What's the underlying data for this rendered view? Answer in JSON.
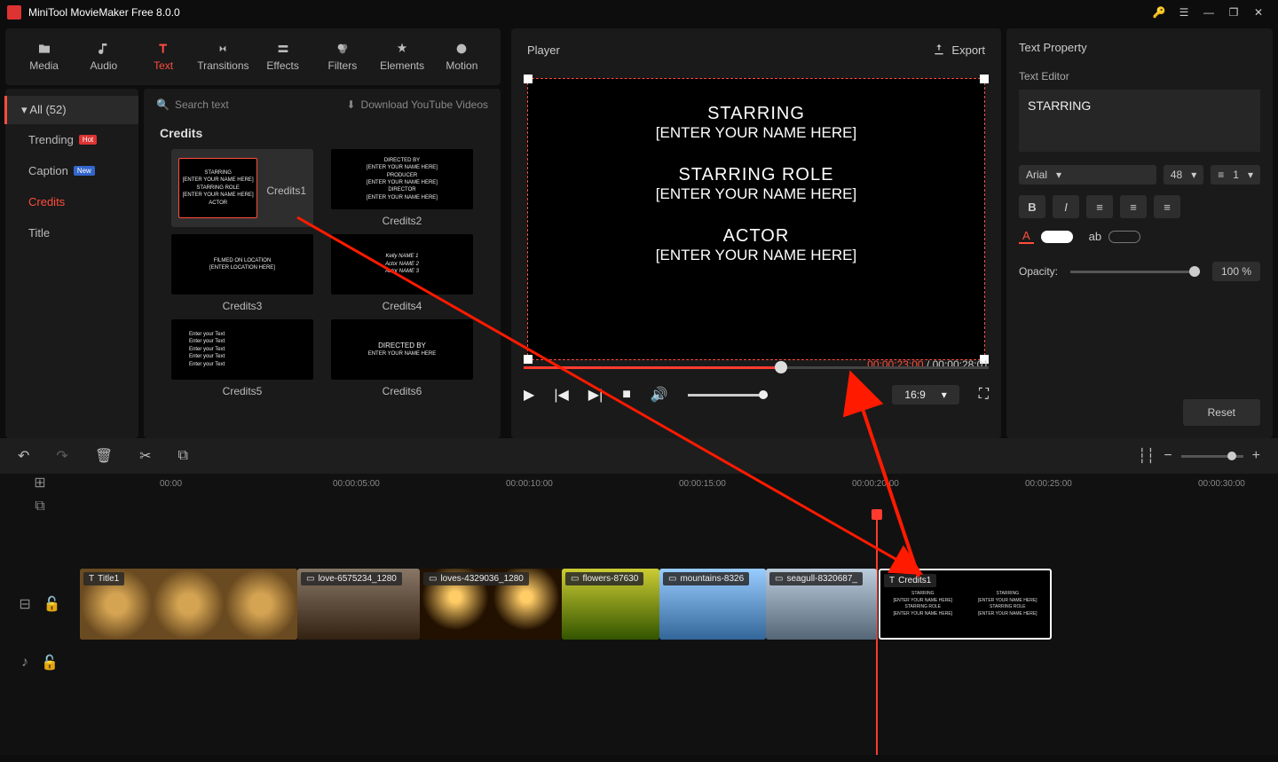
{
  "app": {
    "title": "MiniTool MovieMaker Free 8.0.0"
  },
  "tabs": [
    {
      "label": "Media"
    },
    {
      "label": "Audio"
    },
    {
      "label": "Text"
    },
    {
      "label": "Transitions"
    },
    {
      "label": "Effects"
    },
    {
      "label": "Filters"
    },
    {
      "label": "Elements"
    },
    {
      "label": "Motion"
    }
  ],
  "categories": {
    "all": "All (52)",
    "items": [
      {
        "label": "Trending",
        "badge": "Hot"
      },
      {
        "label": "Caption",
        "badge": "New"
      },
      {
        "label": "Credits",
        "active": true
      },
      {
        "label": "Title"
      }
    ]
  },
  "search": {
    "placeholder": "Search text",
    "download": "Download YouTube Videos"
  },
  "heading": "Credits",
  "thumbs": [
    "Credits1",
    "Credits2",
    "Credits3",
    "Credits4",
    "Credits5",
    "Credits6"
  ],
  "thumb_lines": {
    "c1": [
      "STARRING",
      "[ENTER YOUR NAME HERE]",
      "STARRING ROLE",
      "[ENTER YOUR NAME HERE]",
      "ACTOR"
    ],
    "c2": [
      "DIRECTED BY",
      "[ENTER YOUR NAME HERE]",
      "PRODUCER",
      "[ENTER YOUR NAME HERE]",
      "DIRECTOR",
      "[ENTER YOUR NAME HERE]"
    ],
    "c3": [
      "FILMED ON LOCATION",
      "[ENTER LOCATION HERE]"
    ],
    "c4": [
      "Kelly NAME 1",
      "Actor NAME 2",
      "Actor NAME 3"
    ],
    "c5": [
      "Enter your Text",
      "Enter your Text",
      "Enter your Text",
      "Enter your Text",
      "Enter your Text"
    ],
    "c6": [
      "DIRECTED BY",
      "ENTER YOUR NAME HERE"
    ]
  },
  "player": {
    "title": "Player",
    "export": "Export",
    "lines": {
      "l1": "STARRING",
      "l2": "[ENTER YOUR NAME HERE]",
      "l3": "STARRING ROLE",
      "l4": "[ENTER YOUR NAME HERE]",
      "l5": "ACTOR",
      "l6": "[ENTER YOUR NAME HERE]"
    },
    "time_current": "00:00:23:00",
    "time_sep": " / ",
    "time_total": "00:00:28:01",
    "aspect": "16:9"
  },
  "props": {
    "title": "Text Property",
    "editor": "Text Editor",
    "text": "STARRING",
    "font": "Arial",
    "size": "48",
    "spacing": "1",
    "opacity_label": "Opacity:",
    "opacity_value": "100 %",
    "reset": "Reset"
  },
  "ruler": [
    "00:00",
    "00:00:05:00",
    "00:00:10:00",
    "00:00:15:00",
    "00:00:20:00",
    "00:00:25:00",
    "00:00:30:00"
  ],
  "clips": [
    {
      "label": "Title1"
    },
    {
      "label": "love-6575234_1280"
    },
    {
      "label": "loves-4329036_1280"
    },
    {
      "label": "flowers-87630"
    },
    {
      "label": "mountains-8326"
    },
    {
      "label": "seagull-8320687_"
    },
    {
      "label": "Credits1"
    }
  ],
  "credits_mini": [
    "STARRING",
    "[ENTER YOUR NAME HERE]",
    "STARRING ROLE",
    "[ENTER YOUR NAME HERE]"
  ]
}
